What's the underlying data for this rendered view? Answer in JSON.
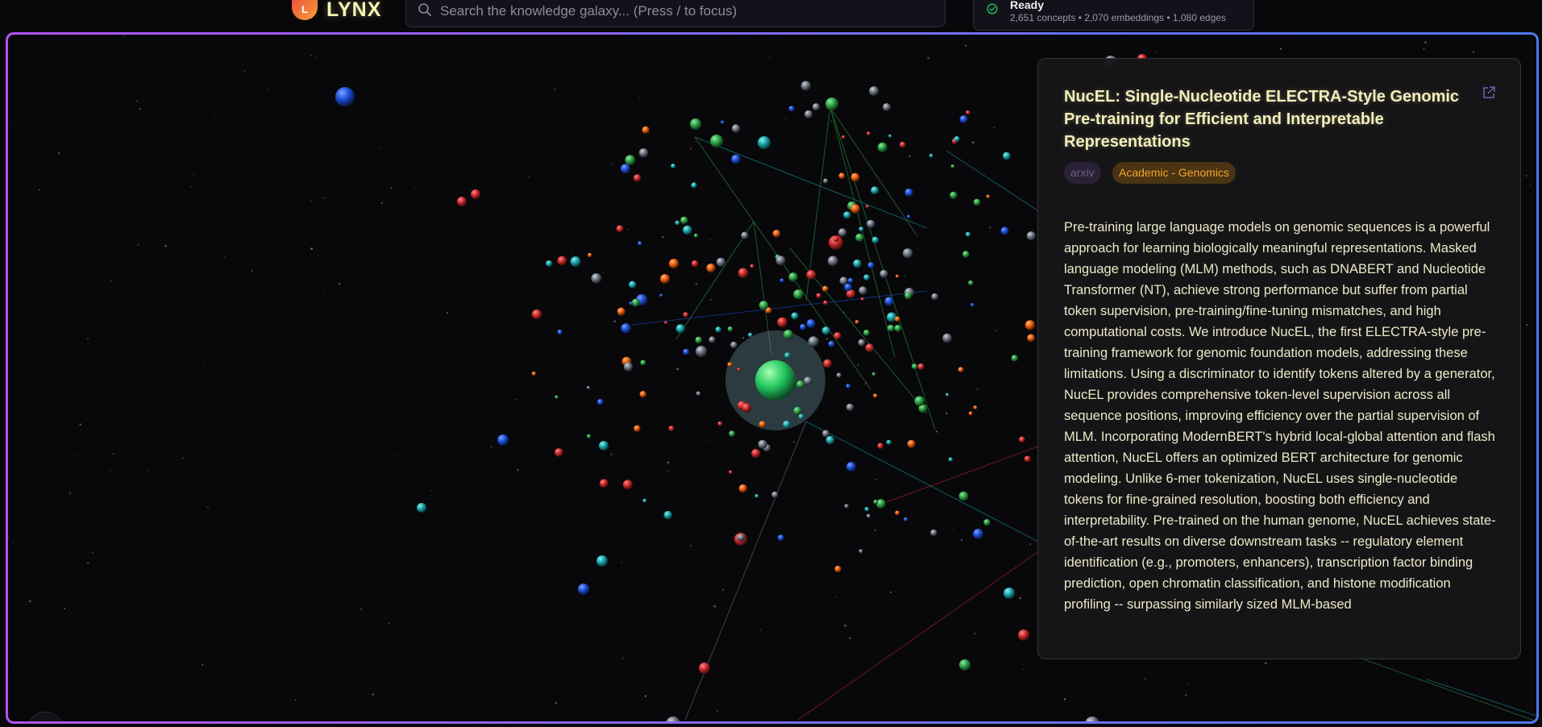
{
  "app": {
    "logo_letter": "L",
    "name": "LYNX"
  },
  "search": {
    "placeholder": "Search the knowledge galaxy... (Press / to focus)",
    "value": ""
  },
  "status": {
    "title": "Ready",
    "stats": "2,651 concepts • 2,070 embeddings • 1,080 edges",
    "icon": "check-circle-icon",
    "color": "#22c55e"
  },
  "detail_panel": {
    "title": "NucEL: Single-Nucleotide ELECTRA-Style Genomic Pre-training for Efficient and Interpretable Representations",
    "tags": [
      "arxiv",
      "Academic - Genomics"
    ],
    "abstract": "Pre-training large language models on genomic sequences is a powerful approach for learning biologically meaningful representations. Masked language modeling (MLM) methods, such as DNABERT and Nucleotide Transformer (NT), achieve strong performance but suffer from partial token supervision, pre-training/fine-tuning mismatches, and high computational costs. We introduce NucEL, the first ELECTRA-style pre-training framework for genomic foundation models, addressing these limitations. Using a discriminator to identify tokens altered by a generator, NucEL provides comprehensive token-level supervision across all sequence positions, improving efficiency over the partial supervision of MLM. Incorporating ModernBERT's hybrid local-global attention and flash attention, NucEL offers an optimized BERT architecture for genomic modeling. Unlike 6-mer tokenization, NucEL uses single-nucleotide tokens for fine-grained resolution, boosting both efficiency and interpretability. Pre-trained on the human genome, NucEL achieves state-of-the-art results on diverse downstream tasks -- regulatory element identification (e.g., promoters, enhancers), transcription factor binding prediction, open chromatin classification, and histone modification profiling -- surpassing similarly sized MLM-based",
    "link_icon": "external-link-icon"
  },
  "colors": {
    "accent_gradient": [
      "#b454f0",
      "#4f78f0"
    ],
    "node_palette": [
      "#2f9e44",
      "#c92a2a",
      "#1c4fd8",
      "#1aa3a8",
      "#e8590c",
      "#6b7280"
    ],
    "selected_node": "#22c55e",
    "tag_category": "#f5a524"
  },
  "controls": {
    "settings_icon": "sliders-icon"
  }
}
